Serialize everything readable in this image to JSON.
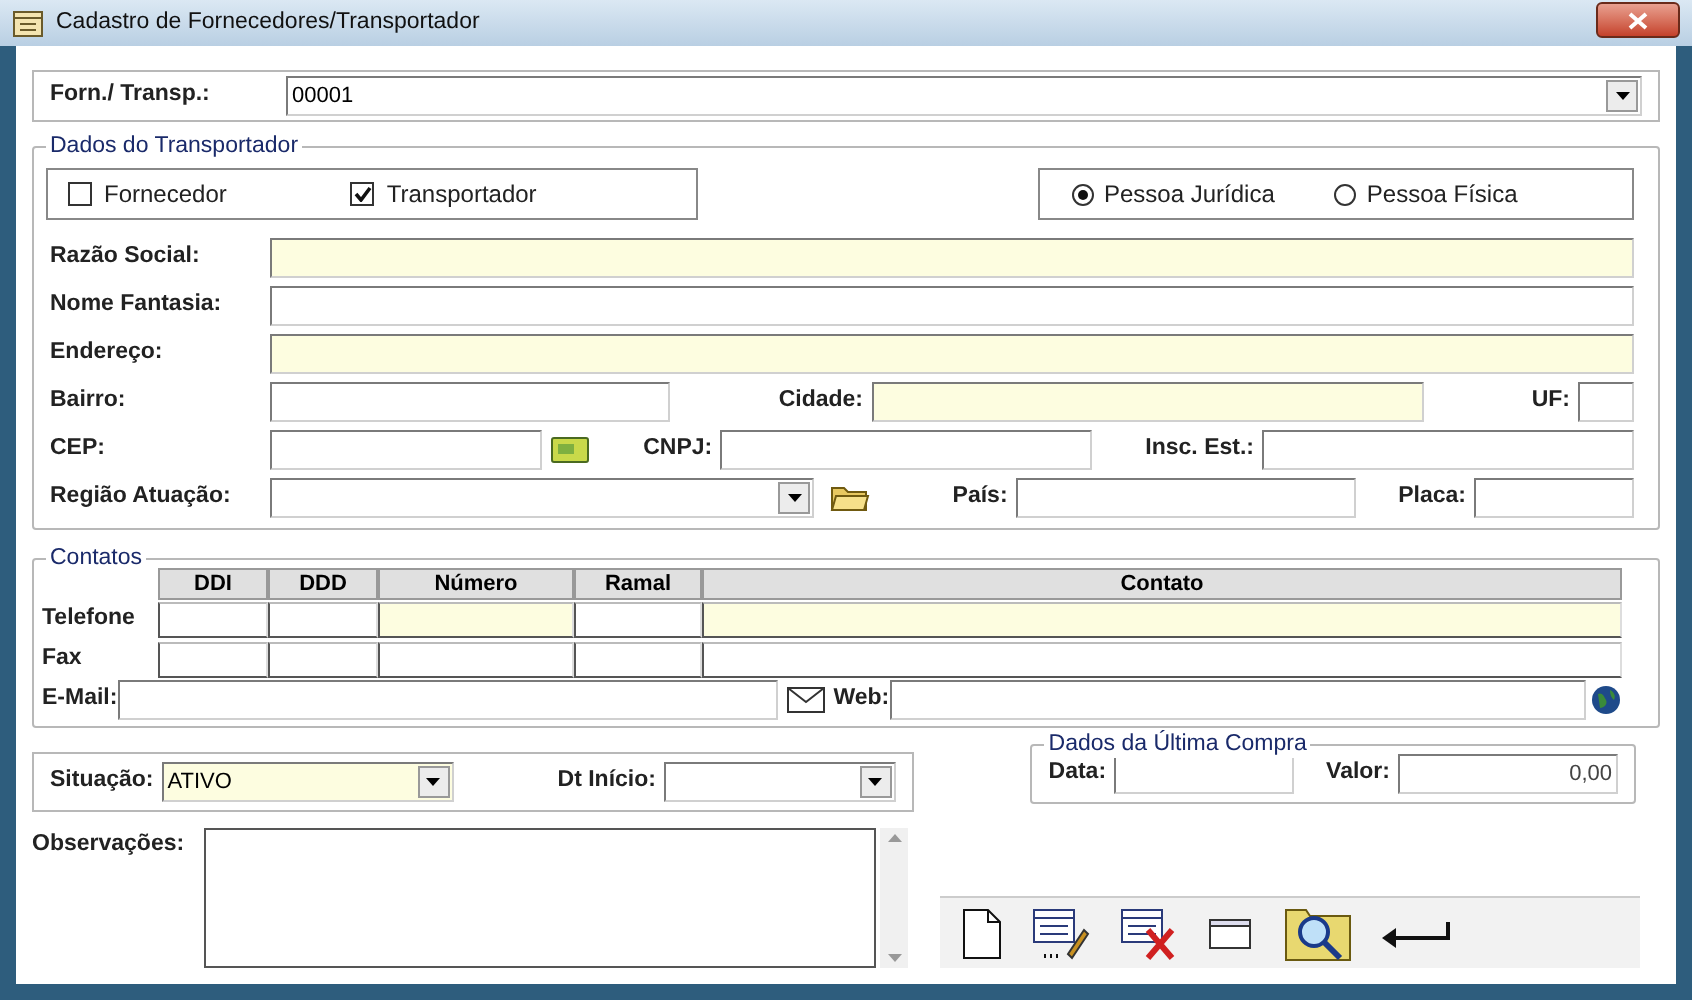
{
  "window": {
    "title": "Cadastro de Fornecedores/Transportador"
  },
  "supplier": {
    "label": "Forn./ Transp.:",
    "value": "00001"
  },
  "transporter": {
    "title": "Dados do Transportador",
    "checkboxes": [
      {
        "label": "Fornecedor",
        "checked": false
      },
      {
        "label": "Transportador",
        "checked": true
      }
    ],
    "radios": [
      {
        "label": "Pessoa Jurídica",
        "selected": true
      },
      {
        "label": "Pessoa Física",
        "selected": false
      }
    ],
    "rows": [
      [
        {
          "label": "Razão Social:",
          "kind": "text",
          "highlighted": true
        }
      ],
      [
        {
          "label": "Nome Fantasia:",
          "kind": "text",
          "highlighted": false
        }
      ],
      [
        {
          "label": "Endereço:",
          "kind": "text",
          "highlighted": true
        }
      ],
      [
        {
          "label": "Bairro:",
          "kind": "text",
          "highlighted": false
        },
        {
          "label": "Cidade:",
          "kind": "text",
          "highlighted": true
        },
        {
          "label": "UF:",
          "kind": "text",
          "highlighted": false
        }
      ],
      [
        {
          "label": "CEP:",
          "kind": "lookup",
          "highlighted": false
        },
        {
          "label": "CNPJ:",
          "kind": "text",
          "highlighted": false
        },
        {
          "label": "Insc. Est.:",
          "kind": "text",
          "highlighted": false
        }
      ],
      [
        {
          "label": "Região Atuação:",
          "kind": "combo",
          "highlighted": false
        },
        {
          "label": "País:",
          "kind": "text",
          "highlighted": false
        },
        {
          "label": "Placa:",
          "kind": "text",
          "highlighted": false
        }
      ]
    ]
  },
  "contacts": {
    "title": "Contatos",
    "columns": [
      "DDI",
      "DDD",
      "Número",
      "Ramal",
      "Contato"
    ],
    "rows": [
      {
        "label": "Telefone",
        "cells": [
          false,
          false,
          true,
          false,
          true
        ]
      },
      {
        "label": "Fax",
        "cells": [
          false,
          false,
          false,
          false,
          false
        ]
      }
    ],
    "email": {
      "label": "E-Mail:"
    },
    "web": {
      "label": "Web:"
    }
  },
  "status": {
    "label": "Situação:",
    "value": "ATIVO"
  },
  "start_date": {
    "label": "Dt Início:"
  },
  "last_purchase": {
    "title": "Dados da Última Compra",
    "date_label": "Data:",
    "value_label": "Valor:",
    "value": "0,00"
  },
  "notes": {
    "label": "Observações:"
  }
}
